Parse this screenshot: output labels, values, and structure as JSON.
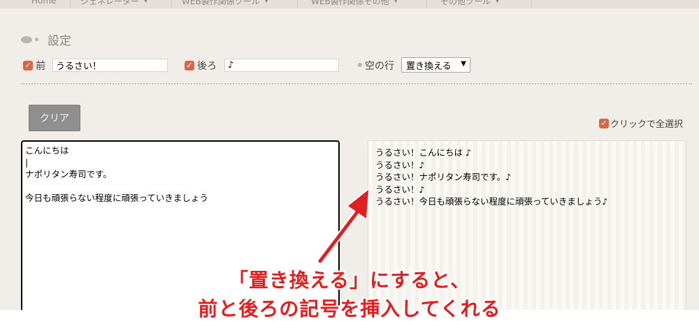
{
  "nav": {
    "items": [
      {
        "label": "Home",
        "has_caret": false
      },
      {
        "label": "ジェネレーター",
        "has_caret": true
      },
      {
        "label": "WEB製作関係ツール",
        "has_caret": true
      },
      {
        "label": "WEB製作関係その他",
        "has_caret": true
      },
      {
        "label": "その他ツール",
        "has_caret": true
      }
    ],
    "caret_icon": "chevron-down-icon"
  },
  "settings": {
    "title": "設定",
    "before": {
      "label": "前",
      "checked": true,
      "value": "うるさい！"
    },
    "after": {
      "label": "後ろ",
      "checked": true,
      "value": "♪"
    },
    "empty_line": {
      "label": "空の行",
      "selected": "置き換える"
    }
  },
  "controls": {
    "clear_label": "クリア",
    "select_all_label": "クリックで全選択",
    "select_all_checked": true
  },
  "input_text": "こんにちは\n|\nナポリタン寿司です。\n\n今日も頑張らない程度に頑張っていきましょう",
  "output_text": "うるさい！こんにちは ♪\nうるさい！♪\nうるさい！ナポリタン寿司です。♪\nうるさい！♪\nうるさい！今日も頑張らない程度に頑張っていきましょう♪",
  "annotation": {
    "line1": "「置き換える」にすると、",
    "line2": "前と後ろの記号を挿入してくれる",
    "color": "#e02020"
  },
  "colors": {
    "accent": "#d9654c",
    "background": "#f1eee9",
    "button": "#8f8f8f"
  }
}
